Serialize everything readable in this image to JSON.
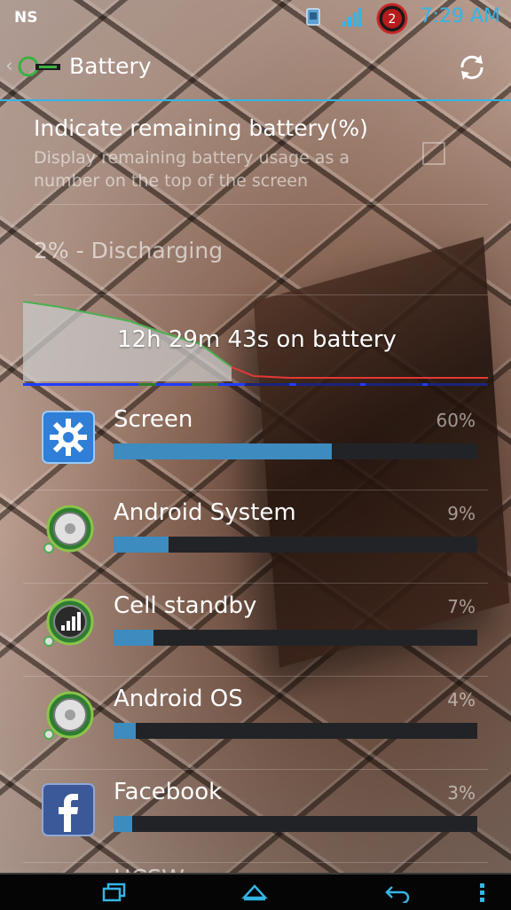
{
  "status_bar": {
    "carrier": "NS",
    "time": "7:29 AM",
    "badge_count": "2"
  },
  "action_bar": {
    "title": "Battery"
  },
  "setting": {
    "title": "Indicate remaining battery(%)",
    "summary": "Display remaining battery usage as a number on the top of the screen",
    "checked": false
  },
  "status": {
    "text": "2% - Discharging"
  },
  "graph": {
    "label": "12h 29m 43s on battery",
    "line_color": "#4caf50",
    "low_color": "#e53935"
  },
  "items": [
    {
      "name": "Screen",
      "percent": "60%",
      "fraction": 0.6,
      "icon": "screen-settings-icon"
    },
    {
      "name": "Android System",
      "percent": "9%",
      "fraction": 0.15,
      "icon": "android-system-icon"
    },
    {
      "name": "Cell standby",
      "percent": "7%",
      "fraction": 0.11,
      "icon": "cell-standby-icon"
    },
    {
      "name": "Android OS",
      "percent": "4%",
      "fraction": 0.06,
      "icon": "android-os-icon"
    },
    {
      "name": "Facebook",
      "percent": "3%",
      "fraction": 0.05,
      "icon": "facebook-icon"
    }
  ],
  "partial_item": {
    "name": "HCSW"
  },
  "colors": {
    "accent": "#33b5e5",
    "bar_fill": "#3d8bbf",
    "bar_track": "#222327"
  }
}
